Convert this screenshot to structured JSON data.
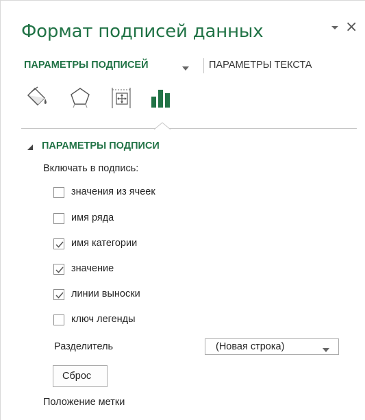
{
  "pane": {
    "title": "Формат подписей данных"
  },
  "tabs": {
    "active": "ПАРАМЕТРЫ ПОДПИСЕЙ",
    "inactive": "ПАРАМЕТРЫ ТЕКСТА"
  },
  "icon_tabs": [
    {
      "name": "fill-line-icon",
      "selected": false
    },
    {
      "name": "effects-pentagon-icon",
      "selected": false
    },
    {
      "name": "size-properties-icon",
      "selected": false
    },
    {
      "name": "label-options-bar-chart-icon",
      "selected": true
    }
  ],
  "section": {
    "title": "ПАРАМЕТРЫ ПОДПИСИ",
    "include_label": "Включать в подпись:",
    "checkboxes": [
      {
        "label": "значения из ячеек",
        "checked": false
      },
      {
        "label": "имя ряда",
        "checked": false
      },
      {
        "label": "имя категории",
        "checked": true
      },
      {
        "label": "значение",
        "checked": true
      },
      {
        "label": "линии выноски",
        "checked": true
      },
      {
        "label": "ключ легенды",
        "checked": false
      }
    ],
    "separator_label": "Разделитель",
    "separator_value": "(Новая строка)",
    "reset_label": "Сброс",
    "position_label": "Положение метки"
  },
  "colors": {
    "accent": "#217346",
    "text": "#262626",
    "check": "#555555"
  }
}
